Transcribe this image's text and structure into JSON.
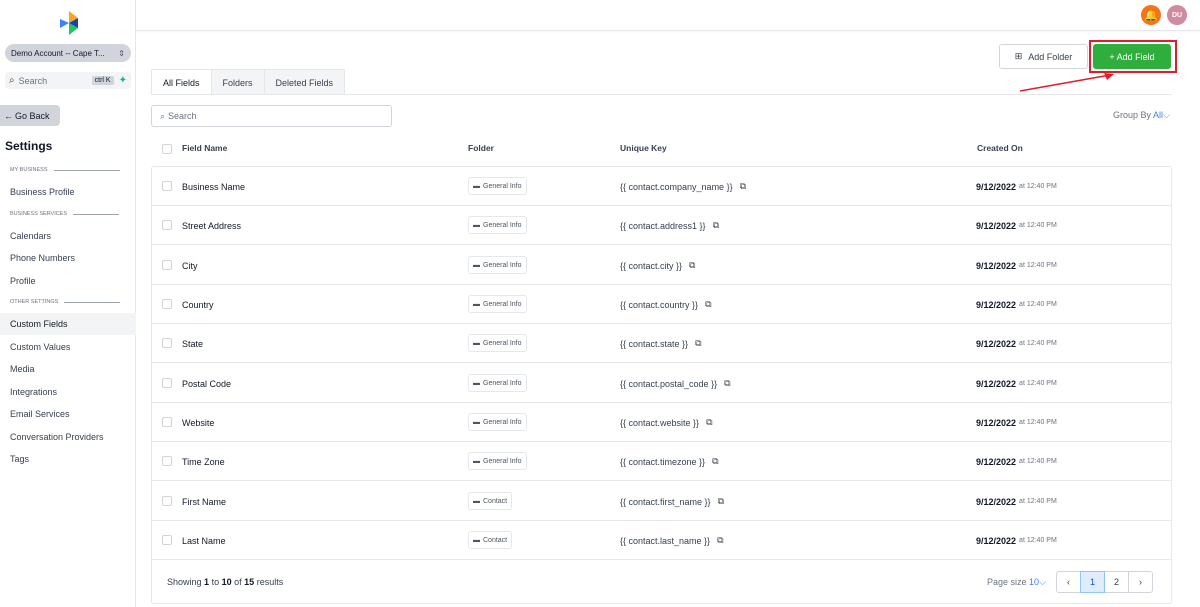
{
  "sidebar": {
    "account": "Demo Account -- Cape T...",
    "search_placeholder": "Search",
    "search_shortcut": "ctrl K",
    "go_back": "Go Back",
    "title": "Settings",
    "sections": {
      "my_business": "MY BUSINESS",
      "business_services": "BUSINESS SERVICES",
      "other_settings": "OTHER SETTINGS"
    },
    "items": {
      "business_profile": "Business Profile",
      "calendars": "Calendars",
      "phone_numbers": "Phone Numbers",
      "profile": "Profile",
      "custom_fields": "Custom Fields",
      "custom_values": "Custom Values",
      "media": "Media",
      "integrations": "Integrations",
      "email_services": "Email Services",
      "conversation_providers": "Conversation Providers",
      "tags": "Tags"
    }
  },
  "topbar": {
    "avatar_initials": "DU"
  },
  "header": {
    "add_folder": "Add Folder",
    "add_field": "+ Add Field"
  },
  "tabs": [
    "All Fields",
    "Folders",
    "Deleted Fields"
  ],
  "search": {
    "placeholder": "Search"
  },
  "group_by": {
    "label": "Group By",
    "value": "All"
  },
  "table": {
    "headers": {
      "field_name": "Field Name",
      "folder": "Folder",
      "unique_key": "Unique Key",
      "created_on": "Created On"
    },
    "rows": [
      {
        "name": "Business Name",
        "folder": "General Info",
        "key": "{{ contact.company_name }}",
        "date": "9/12/2022",
        "time": "at 12:40 PM"
      },
      {
        "name": "Street Address",
        "folder": "General Info",
        "key": "{{ contact.address1 }}",
        "date": "9/12/2022",
        "time": "at 12:40 PM"
      },
      {
        "name": "City",
        "folder": "General Info",
        "key": "{{ contact.city }}",
        "date": "9/12/2022",
        "time": "at 12:40 PM"
      },
      {
        "name": "Country",
        "folder": "General Info",
        "key": "{{ contact.country }}",
        "date": "9/12/2022",
        "time": "at 12:40 PM"
      },
      {
        "name": "State",
        "folder": "General Info",
        "key": "{{ contact.state }}",
        "date": "9/12/2022",
        "time": "at 12:40 PM"
      },
      {
        "name": "Postal Code",
        "folder": "General Info",
        "key": "{{ contact.postal_code }}",
        "date": "9/12/2022",
        "time": "at 12:40 PM"
      },
      {
        "name": "Website",
        "folder": "General Info",
        "key": "{{ contact.website }}",
        "date": "9/12/2022",
        "time": "at 12:40 PM"
      },
      {
        "name": "Time Zone",
        "folder": "General Info",
        "key": "{{ contact.timezone }}",
        "date": "9/12/2022",
        "time": "at 12:40 PM"
      },
      {
        "name": "First Name",
        "folder": "Contact",
        "key": "{{ contact.first_name }}",
        "date": "9/12/2022",
        "time": "at 12:40 PM"
      },
      {
        "name": "Last Name",
        "folder": "Contact",
        "key": "{{ contact.last_name }}",
        "date": "9/12/2022",
        "time": "at 12:40 PM"
      }
    ]
  },
  "footer": {
    "showing_prefix": "Showing",
    "range_start": "1",
    "to": "to",
    "range_end": "10",
    "of": "of",
    "total": "15",
    "suffix": "results",
    "page_size_label": "Page size",
    "page_size_value": "10",
    "pages": [
      "1",
      "2"
    ],
    "current_page": "1"
  },
  "colors": {
    "accent_green": "#2fae3d",
    "highlight_red": "#e11d2b",
    "bell_orange": "#f97316",
    "link_blue": "#3b82f6"
  },
  "icons": [
    "logo-icon",
    "chevron-updown-icon",
    "search-icon",
    "sparkle-icon",
    "arrow-left-icon",
    "bell-icon",
    "folder-plus-icon",
    "folder-icon",
    "copy-icon",
    "chevron-down-icon",
    "chevron-left-icon",
    "chevron-right-icon"
  ]
}
